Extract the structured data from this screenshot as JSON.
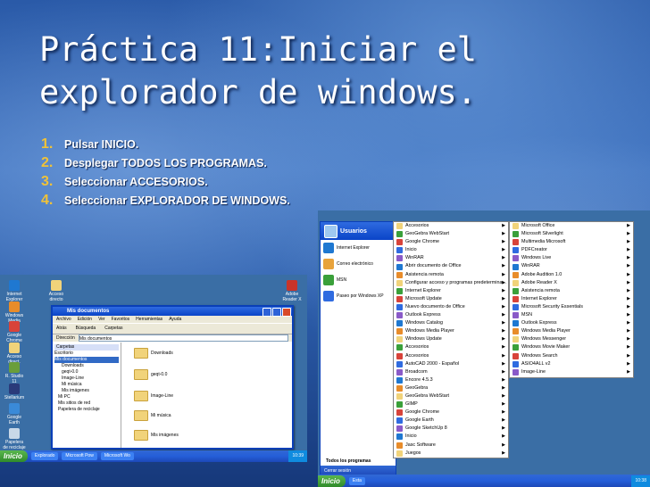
{
  "slide": {
    "title": "Práctica 11:Iniciar el explorador de windows.",
    "steps": [
      {
        "num": "1.",
        "text": "Pulsar INICIO."
      },
      {
        "num": "2.",
        "text": "Desplegar TODOS LOS PROGRAMAS."
      },
      {
        "num": "3.",
        "text": "Seleccionar ACCESORIOS."
      },
      {
        "num": "4.",
        "text": "Seleccionar EXPLORADOR DE WINDOWS."
      }
    ]
  },
  "shot1": {
    "desktop_icons": [
      "Internet Explorer",
      "Windows Media",
      "Google Chrome",
      "Acceso direct.",
      "R. Studio 11",
      "Stellarium",
      "Google Earth",
      "Papelera de reciclaje"
    ],
    "right_icons": [
      "Adobe Reader X",
      "Acceso directo"
    ],
    "window": {
      "title": "Mis documentos",
      "menu": [
        "Archivo",
        "Edición",
        "Ver",
        "Favoritos",
        "Herramientas",
        "Ayuda"
      ],
      "toolbar": [
        "Atrás",
        "Búsqueda",
        "Carpetas"
      ],
      "address_label": "Dirección",
      "address_value": "Mis documentos",
      "tree_header": "Carpetas",
      "tree": [
        "Escritorio",
        "Mis documentos",
        "Downloads",
        "geqt-0.0",
        "Image-Line",
        "Mi música",
        "Mis imágenes",
        "Mi PC",
        "Mis sitios de red",
        "Papelera de reciclaje"
      ],
      "folders": [
        "Downloads",
        "geqt-0.0",
        "Image-Line",
        "Mi música",
        "Mis imágenes"
      ]
    },
    "taskbar": {
      "start": "Inicio",
      "tasks": [
        "Explorado",
        "Microsoft Pow",
        "Microsoft Wo"
      ],
      "clock": "10:39"
    }
  },
  "shot2": {
    "user": "Usuarios",
    "pinned": [
      {
        "label": "Internet Explorer",
        "color": "#1f78d1"
      },
      {
        "label": "Correo electrónico",
        "color": "#e8a33c"
      },
      {
        "label": "MSN",
        "color": "#3aa03a"
      },
      {
        "label": "Paseo por Windows XP",
        "color": "#2f6be0"
      }
    ],
    "all_programs": "Todos los programas",
    "logoff": "Cerrar sesión",
    "col1": [
      "Accesorios",
      "GeoGebra WebStart",
      "Google Chrome",
      "Inicio",
      "WinRAR",
      "Abrir documento de Office",
      "Asistencia remota",
      "Configurar acceso y programas predetermina...",
      "Internet Explorer",
      "Microsoft Update",
      "Nuevo documento de Office",
      "Outlook Express",
      "Windows Catalog",
      "Windows Media Player",
      "Windows Update",
      "Accesorios",
      "Accesorios",
      "AutoCAD 2000 - Español",
      "Broadcom",
      "Encore 4.5.3",
      "GeoGebra",
      "GeoGebra WebStart",
      "GIMP",
      "Google Chrome",
      "Google Earth",
      "Google SketchUp 8",
      "Inicio",
      "Jasc Software",
      "Juegos"
    ],
    "col2": [
      "Microsoft Office",
      "Microsoft Silverlight",
      "Multimedia Microsoft",
      "PDFCreator",
      "Windows Live",
      "WinRAR",
      "Adobe Audition 1.0",
      "Adobe Reader X",
      "Asistencia remota",
      "Internet Explorer",
      "Microsoft Security Essentials",
      "MSN",
      "Outlook Express",
      "Windows Media Player",
      "Windows Messenger",
      "Windows Movie Maker",
      "Windows Search",
      "ASIO4ALL v2",
      "Image-Line"
    ],
    "taskbar": {
      "start": "Inicio",
      "task": "Esta",
      "clock": "10:38"
    }
  }
}
